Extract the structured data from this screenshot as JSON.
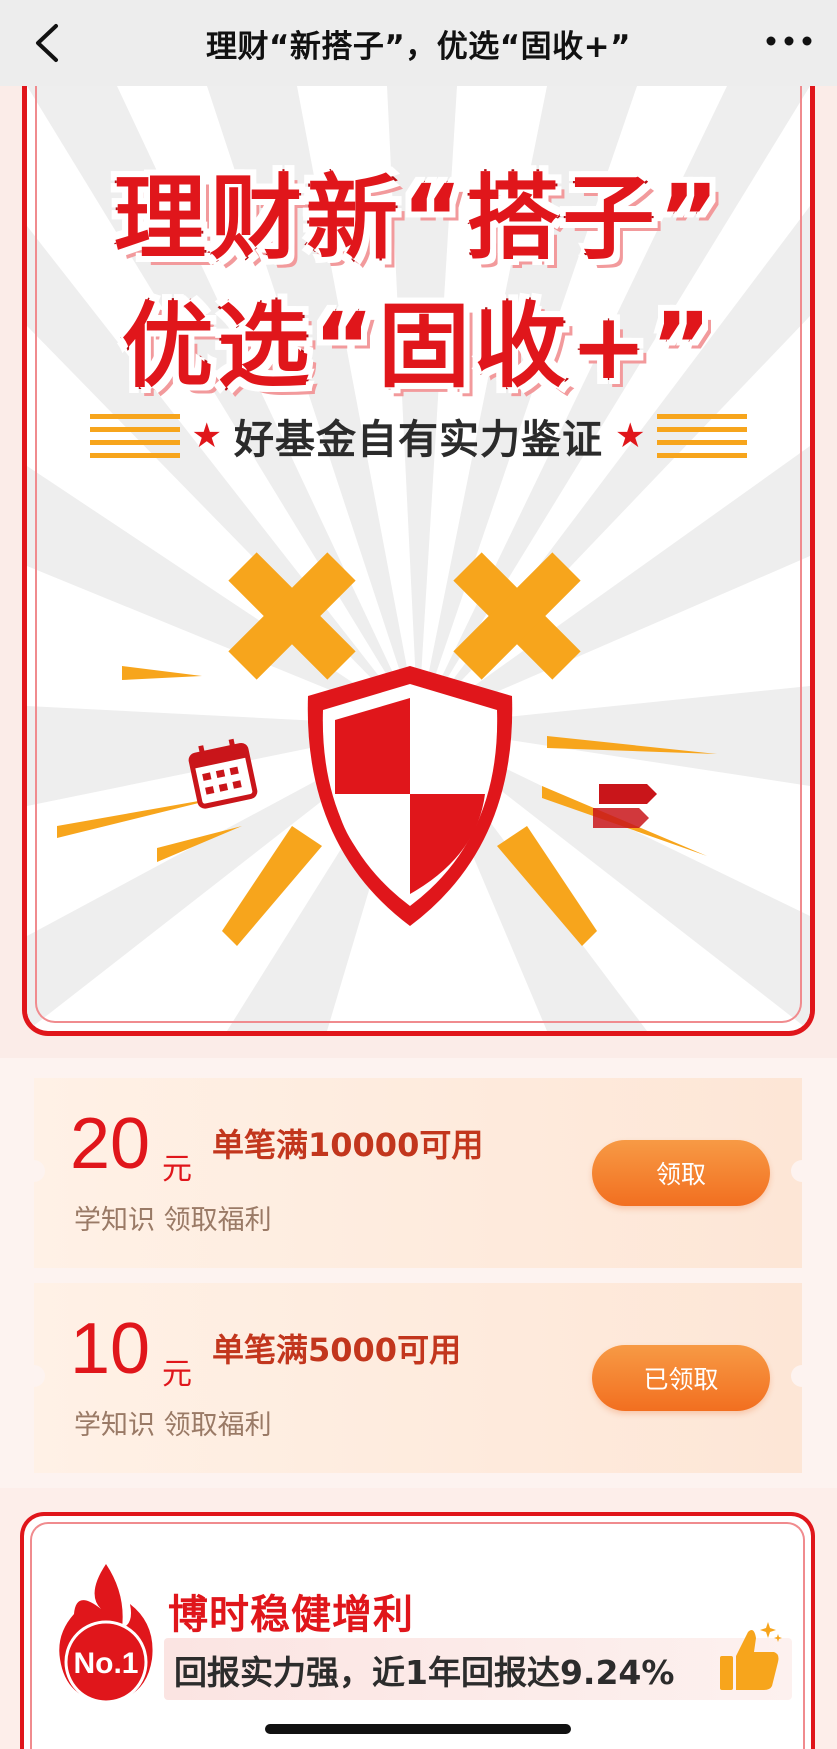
{
  "navbar": {
    "title": "理财“新搭子”，优选“固收+”",
    "back_icon": "chevron-left-icon",
    "more_icon": "more-dots-icon"
  },
  "banner": {
    "headline_line1": "理财新“搭子”",
    "headline_line2": "优选“固收+”",
    "tagline": "好基金自有实力鉴证",
    "star": "★",
    "colors": {
      "red": "#e0161b",
      "orange": "#f7a51c"
    },
    "icons": [
      "star-icon",
      "calendar-icon",
      "shield-icon",
      "sword-icon",
      "arrow-flag-icon"
    ]
  },
  "coupons": [
    {
      "amount": "20",
      "unit": "元",
      "condition": "单笔满10000可用",
      "subtitle": "学知识 领取福利",
      "button": "领取"
    },
    {
      "amount": "10",
      "unit": "元",
      "condition": "单笔满5000可用",
      "subtitle": "学知识 领取福利",
      "button": "已领取"
    }
  ],
  "fund_card": {
    "rank": "No.1",
    "name": "博时稳健增利",
    "description": "回报实力强，近1年回报达9.24%",
    "icon": "thumbs-up-icon"
  }
}
